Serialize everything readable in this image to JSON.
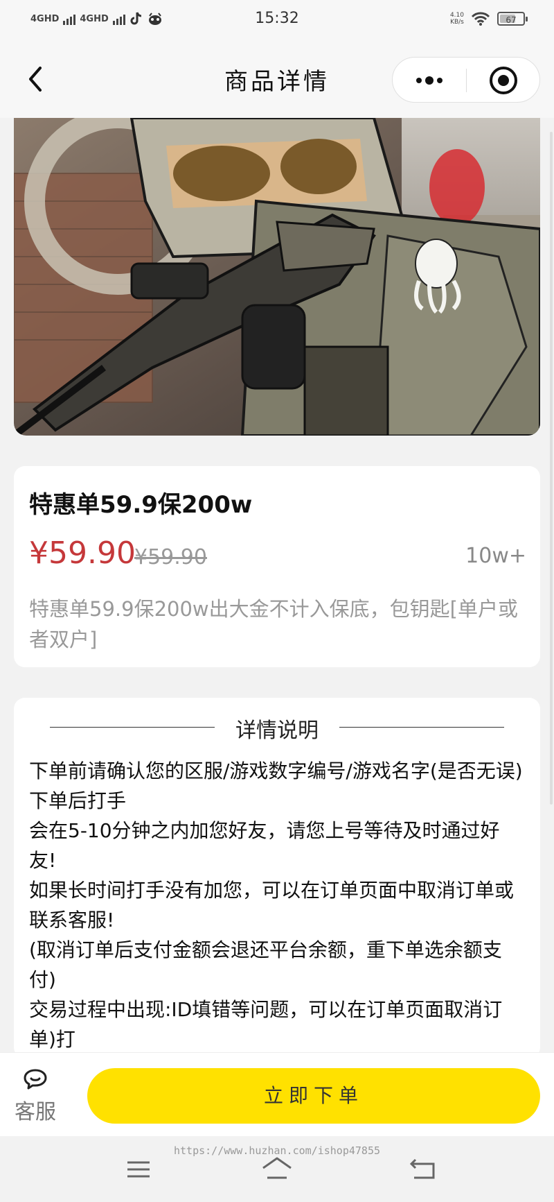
{
  "status_bar": {
    "network_1": "4GHD",
    "network_2": "4GHD",
    "time": "15:32",
    "speed_value": "4.10",
    "speed_unit": "KB/s",
    "battery": "67"
  },
  "nav": {
    "title": "商品详情"
  },
  "product": {
    "name": "特惠单59.9保200w",
    "price": "¥59.90",
    "original_price": "¥59.90",
    "sold": "10w+",
    "description": "特惠单59.9保200w出大金不计入保底，包钥匙[单户或者双户]"
  },
  "details": {
    "section_title": "详情说明",
    "paragraphs": [
      "下单前请确认您的区服/游戏数字编号/游戏名字(是否无误)下单后打手",
      "会在5-10分钟之内加您好友，请您上号等待及时通过好友!",
      "如果长时间打手没有加您，可以在订单页面中取消订单或联系客服!",
      "(取消订单后支付金额会退还平台余额，重下单选余额支付)",
      "交易过程中出现:ID填错等问题，可以在订单页面取消订单)打"
    ]
  },
  "bottom": {
    "service_label": "客服",
    "order_button": "立即下单"
  },
  "watermark": "https://www.huzhan.com/ishop47855",
  "colors": {
    "price": "#c5383a",
    "order_button": "#ffe100"
  }
}
